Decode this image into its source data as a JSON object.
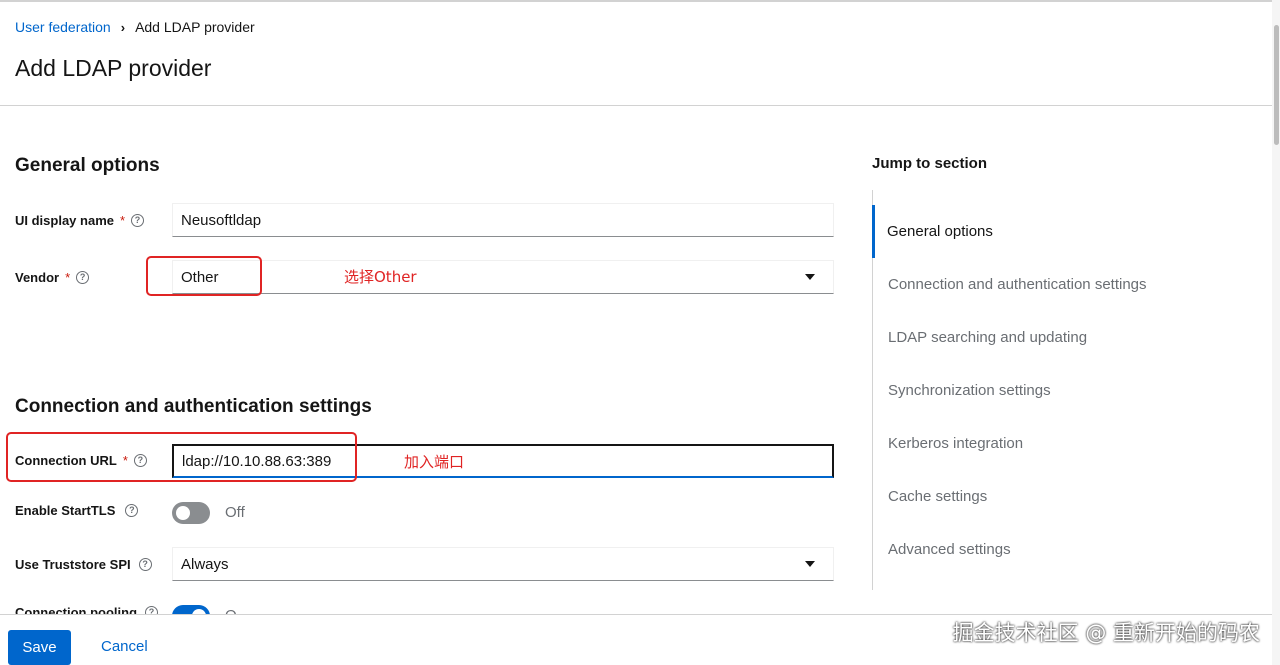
{
  "breadcrumb": {
    "parent": "User federation",
    "current": "Add LDAP provider"
  },
  "page_title": "Add LDAP provider",
  "general": {
    "title": "General options",
    "ui_display_name_label": "UI display name",
    "ui_display_name_value": "Neusoftldap",
    "vendor_label": "Vendor",
    "vendor_value": "Other"
  },
  "connection": {
    "title": "Connection and authentication settings",
    "url_label": "Connection URL",
    "url_value": "ldap://10.10.88.63:389",
    "starttls_label": "Enable StartTLS",
    "starttls_state": "Off",
    "truststore_label": "Use Truststore SPI",
    "truststore_value": "Always",
    "pooling_label": "Connection pooling",
    "pooling_state": "O"
  },
  "required_mark": "*",
  "help_glyph": "?",
  "annotations": {
    "vendor_note": "选择Other",
    "url_note": "加入端口",
    "color": "#e02424"
  },
  "jump": {
    "title": "Jump to section",
    "items": [
      {
        "label": "General options",
        "active": true
      },
      {
        "label": "Connection and authentication settings",
        "active": false
      },
      {
        "label": "LDAP searching and updating",
        "active": false
      },
      {
        "label": "Synchronization settings",
        "active": false
      },
      {
        "label": "Kerberos integration",
        "active": false
      },
      {
        "label": "Cache settings",
        "active": false
      },
      {
        "label": "Advanced settings",
        "active": false
      }
    ]
  },
  "footer": {
    "save": "Save",
    "cancel": "Cancel"
  },
  "watermark": "掘金技术社区 @ 重新开始的码农",
  "colors": {
    "accent": "#0066cc",
    "required": "#c9190b"
  }
}
